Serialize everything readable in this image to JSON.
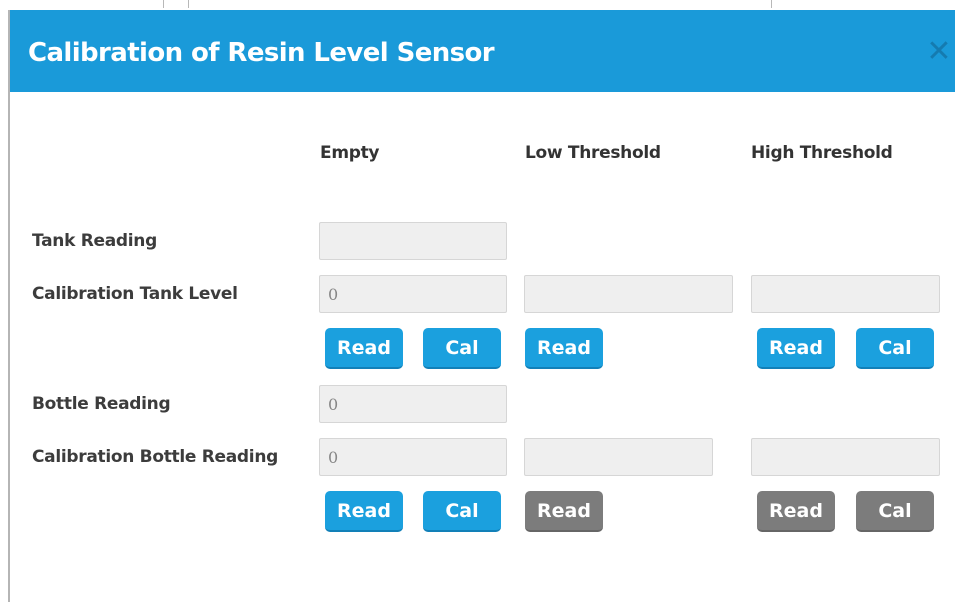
{
  "dialog": {
    "title": "Calibration of Resin Level Sensor",
    "close_glyph": "✕",
    "header_color": "#1a9ad9"
  },
  "columns": {
    "empty": "Empty",
    "low": "Low Threshold",
    "high": "High Threshold"
  },
  "rows": {
    "tank_reading": {
      "label": "Tank Reading",
      "empty_value": ""
    },
    "calibration_tank_level": {
      "label": "Calibration Tank Level",
      "empty_value": "0",
      "low_value": "",
      "high_value": ""
    },
    "bottle_reading": {
      "label": "Bottle Reading",
      "empty_value": "0"
    },
    "calibration_bottle_reading": {
      "label": "Calibration Bottle Reading",
      "empty_value": "0",
      "low_value": "",
      "high_value": ""
    }
  },
  "buttons": {
    "read_label": "Read",
    "cal_label": "Cal",
    "tank_empty_read_state": "enabled",
    "tank_empty_cal_state": "enabled",
    "tank_low_read_state": "enabled",
    "tank_high_read_state": "enabled",
    "tank_high_cal_state": "enabled",
    "bottle_empty_read_state": "enabled",
    "bottle_empty_cal_state": "enabled",
    "bottle_low_read_state": "disabled",
    "bottle_high_read_state": "disabled",
    "bottle_high_cal_state": "disabled",
    "enabled_color": "#1ba0de",
    "disabled_color": "#7c7c7c"
  }
}
